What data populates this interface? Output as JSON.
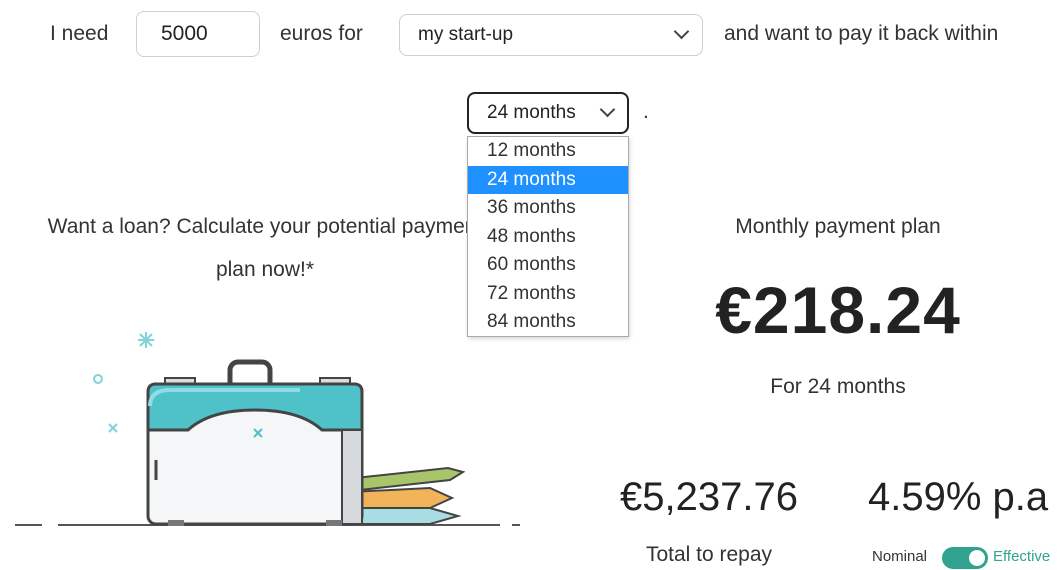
{
  "sentence": {
    "prefix": "I need",
    "amount_value": "5000",
    "currency_text": "euros for",
    "purpose_selected": "my start-up",
    "suffix": "and want to pay it back within",
    "term_selected": "24 months",
    "end_punct": "."
  },
  "term_dropdown": {
    "options": [
      "12 months",
      "24 months",
      "36 months",
      "48 months",
      "60 months",
      "72 months",
      "84 months"
    ],
    "selected_index": 1
  },
  "promo": {
    "line1": "Want a loan? Calculate your potential payment",
    "line2": "plan now!*"
  },
  "result": {
    "title": "Monthly payment plan",
    "monthly_amount": "€218.24",
    "duration_text": "For 24 months",
    "total_value": "€5,237.76",
    "total_label": "Total to repay",
    "rate_value": "4.59% p.a",
    "toggle_left_label": "Nominal",
    "toggle_right_label": "Effective",
    "toggle_on": true
  },
  "colors": {
    "accent_teal": "#2fa38e",
    "dropdown_highlight": "#1e90ff",
    "suitcase_teal": "#4fc1c9"
  },
  "icons": {
    "chevron": "chevron-down-icon",
    "illustration": "briefcase-pencils-illustration"
  }
}
